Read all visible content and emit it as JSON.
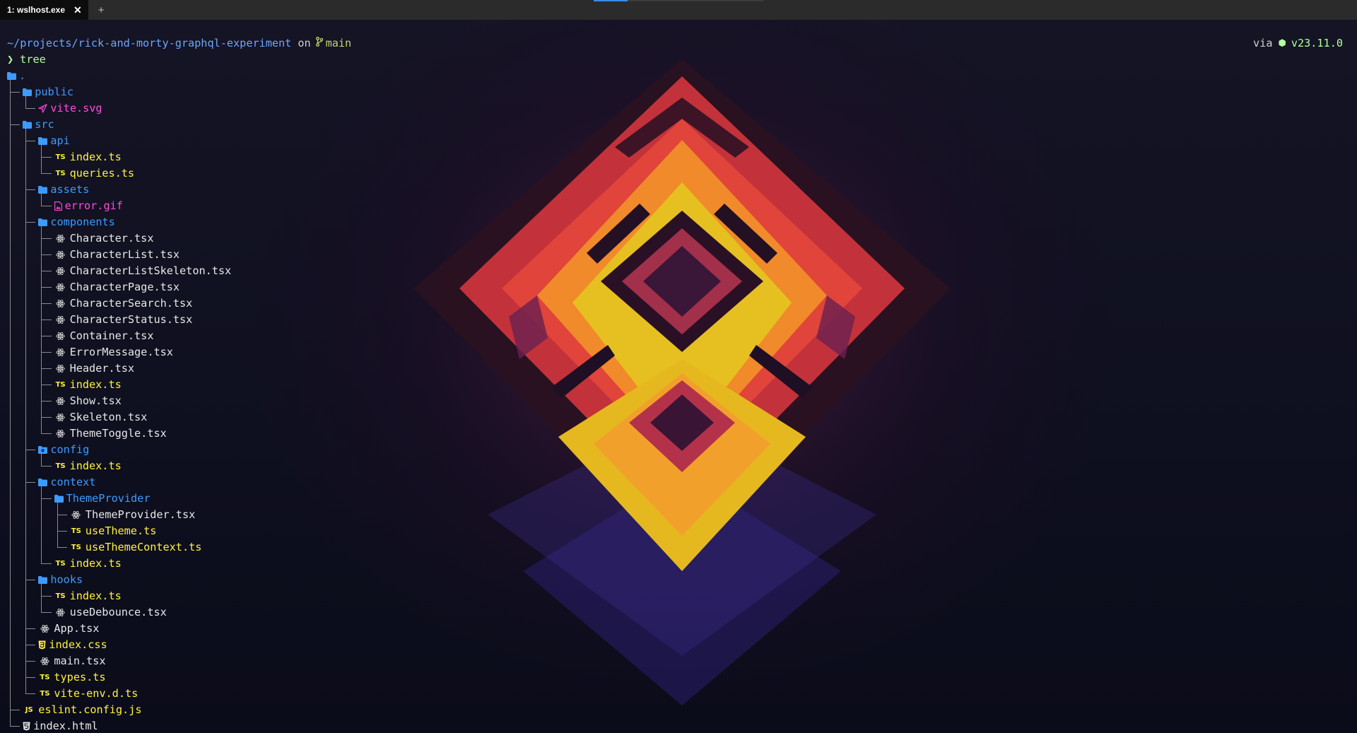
{
  "tab": {
    "title": "1: wslhost.exe",
    "close_symbol": "✕",
    "new_tab_symbol": "+"
  },
  "activity": {
    "progress_fraction": 0.2
  },
  "prompt": {
    "path": "~/projects/rick-and-morty-graphql-experiment",
    "on_word": "on",
    "branch_icon": "git-branch-icon",
    "branch": "main",
    "via_word": "via",
    "runtime_icon": "nodejs-icon",
    "node_version": "v23.11.0",
    "prompt_symbol": "❯",
    "command": "tree"
  },
  "colors": {
    "directory": "#3d9bff",
    "typescript": "#fff23a",
    "tsx": "#e7e7e7",
    "image": "#ff4bd8",
    "command": "#b4ff9e",
    "path": "#6ea6ff",
    "branch": "#c5d36b"
  },
  "tree": [
    {
      "depth": 0,
      "name": ".",
      "kind": "dir",
      "icon": "folder-icon"
    },
    {
      "depth": 1,
      "name": "public",
      "kind": "dir",
      "icon": "folder-icon"
    },
    {
      "depth": 2,
      "name": "vite.svg",
      "kind": "img",
      "icon": "vite-icon",
      "last": true
    },
    {
      "depth": 1,
      "name": "src",
      "kind": "dir",
      "icon": "folder-icon"
    },
    {
      "depth": 2,
      "name": "api",
      "kind": "dir",
      "icon": "folder-icon"
    },
    {
      "depth": 3,
      "name": "index.ts",
      "kind": "ts",
      "icon": "typescript-icon"
    },
    {
      "depth": 3,
      "name": "queries.ts",
      "kind": "ts",
      "icon": "typescript-icon",
      "last": true
    },
    {
      "depth": 2,
      "name": "assets",
      "kind": "dir",
      "icon": "folder-icon"
    },
    {
      "depth": 3,
      "name": "error.gif",
      "kind": "img",
      "icon": "image-file-icon",
      "last": true
    },
    {
      "depth": 2,
      "name": "components",
      "kind": "dir",
      "icon": "folder-icon"
    },
    {
      "depth": 3,
      "name": "Character.tsx",
      "kind": "tsx",
      "icon": "react-icon"
    },
    {
      "depth": 3,
      "name": "CharacterList.tsx",
      "kind": "tsx",
      "icon": "react-icon"
    },
    {
      "depth": 3,
      "name": "CharacterListSkeleton.tsx",
      "kind": "tsx",
      "icon": "react-icon"
    },
    {
      "depth": 3,
      "name": "CharacterPage.tsx",
      "kind": "tsx",
      "icon": "react-icon"
    },
    {
      "depth": 3,
      "name": "CharacterSearch.tsx",
      "kind": "tsx",
      "icon": "react-icon"
    },
    {
      "depth": 3,
      "name": "CharacterStatus.tsx",
      "kind": "tsx",
      "icon": "react-icon"
    },
    {
      "depth": 3,
      "name": "Container.tsx",
      "kind": "tsx",
      "icon": "react-icon"
    },
    {
      "depth": 3,
      "name": "ErrorMessage.tsx",
      "kind": "tsx",
      "icon": "react-icon"
    },
    {
      "depth": 3,
      "name": "Header.tsx",
      "kind": "tsx",
      "icon": "react-icon"
    },
    {
      "depth": 3,
      "name": "index.ts",
      "kind": "ts",
      "icon": "typescript-icon"
    },
    {
      "depth": 3,
      "name": "Show.tsx",
      "kind": "tsx",
      "icon": "react-icon"
    },
    {
      "depth": 3,
      "name": "Skeleton.tsx",
      "kind": "tsx",
      "icon": "react-icon"
    },
    {
      "depth": 3,
      "name": "ThemeToggle.tsx",
      "kind": "tsx",
      "icon": "react-icon",
      "last": true
    },
    {
      "depth": 2,
      "name": "config",
      "kind": "dir",
      "icon": "config-folder-icon"
    },
    {
      "depth": 3,
      "name": "index.ts",
      "kind": "ts",
      "icon": "typescript-icon",
      "last": true
    },
    {
      "depth": 2,
      "name": "context",
      "kind": "dir",
      "icon": "folder-icon"
    },
    {
      "depth": 3,
      "name": "ThemeProvider",
      "kind": "dir",
      "icon": "folder-icon"
    },
    {
      "depth": 4,
      "name": "ThemeProvider.tsx",
      "kind": "tsx",
      "icon": "react-icon"
    },
    {
      "depth": 4,
      "name": "useTheme.ts",
      "kind": "ts",
      "icon": "typescript-icon"
    },
    {
      "depth": 4,
      "name": "useThemeContext.ts",
      "kind": "ts",
      "icon": "typescript-icon",
      "last": true
    },
    {
      "depth": 3,
      "name": "index.ts",
      "kind": "ts",
      "icon": "typescript-icon",
      "last": true
    },
    {
      "depth": 2,
      "name": "hooks",
      "kind": "dir",
      "icon": "folder-icon"
    },
    {
      "depth": 3,
      "name": "index.ts",
      "kind": "ts",
      "icon": "typescript-icon"
    },
    {
      "depth": 3,
      "name": "useDebounce.tsx",
      "kind": "tsx",
      "icon": "react-icon",
      "last": true
    },
    {
      "depth": 2,
      "name": "App.tsx",
      "kind": "tsx",
      "icon": "react-icon"
    },
    {
      "depth": 2,
      "name": "index.css",
      "kind": "css",
      "icon": "css-icon"
    },
    {
      "depth": 2,
      "name": "main.tsx",
      "kind": "tsx",
      "icon": "react-icon"
    },
    {
      "depth": 2,
      "name": "types.ts",
      "kind": "ts",
      "icon": "typescript-icon"
    },
    {
      "depth": 2,
      "name": "vite-env.d.ts",
      "kind": "ts",
      "icon": "typescript-icon",
      "last": true
    },
    {
      "depth": 1,
      "name": "eslint.config.js",
      "kind": "js",
      "icon": "javascript-icon"
    },
    {
      "depth": 1,
      "name": "index.html",
      "kind": "html",
      "icon": "html-icon"
    }
  ]
}
